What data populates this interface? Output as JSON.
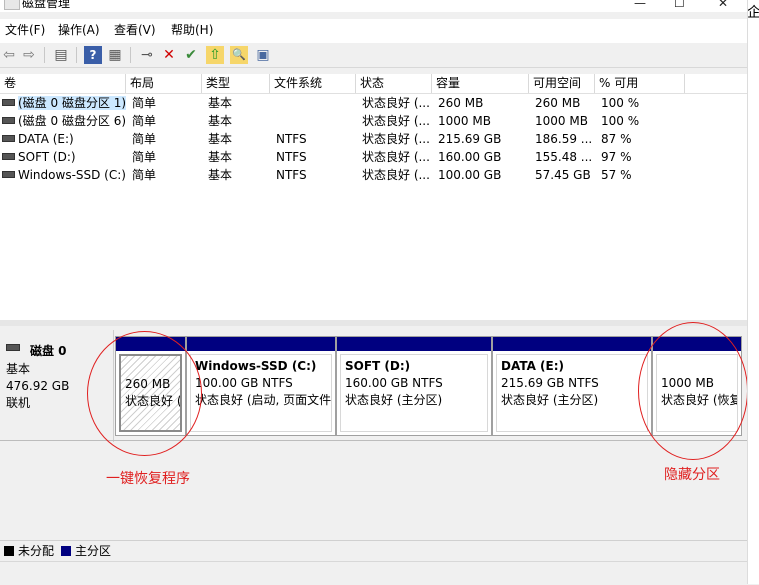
{
  "window": {
    "title": "磁盘管理",
    "minimize_glyph": "—",
    "maximize_glyph": "☐",
    "close_glyph": "✕"
  },
  "menu": [
    "文件(F)",
    "操作(A)",
    "查看(V)",
    "帮助(H)"
  ],
  "toolbar": {
    "icons": [
      "back-icon",
      "forward-icon",
      "console-tree-icon",
      "help-icon",
      "properties-icon",
      "connect-drive-icon",
      "delete-icon",
      "check-icon",
      "open-icon",
      "explore-icon",
      "help-topics-icon"
    ],
    "glyphs": {
      "back": "⇦",
      "forward": "⇨",
      "tree": "▤",
      "help": "?",
      "props": "▦",
      "connect": "⊸",
      "delete": "✕",
      "check": "✔",
      "open": "⇧",
      "explore": "🔍",
      "help2": "▣"
    }
  },
  "volume_table": {
    "headers": [
      "卷",
      "布局",
      "类型",
      "文件系统",
      "状态",
      "容量",
      "可用空间",
      "% 可用"
    ],
    "rows": [
      {
        "volume": "(磁盘 0 磁盘分区 1)",
        "layout": "简单",
        "type": "基本",
        "fs": "",
        "status": "状态良好 (...",
        "capacity": "260 MB",
        "free": "260 MB",
        "pct": "100 %"
      },
      {
        "volume": "(磁盘 0 磁盘分区 6)",
        "layout": "简单",
        "type": "基本",
        "fs": "",
        "status": "状态良好 (...",
        "capacity": "1000 MB",
        "free": "1000 MB",
        "pct": "100 %"
      },
      {
        "volume": "DATA (E:)",
        "layout": "简单",
        "type": "基本",
        "fs": "NTFS",
        "status": "状态良好 (...",
        "capacity": "215.69 GB",
        "free": "186.59 ...",
        "pct": "87 %"
      },
      {
        "volume": "SOFT (D:)",
        "layout": "简单",
        "type": "基本",
        "fs": "NTFS",
        "status": "状态良好 (...",
        "capacity": "160.00 GB",
        "free": "155.48 ...",
        "pct": "97 %"
      },
      {
        "volume": "Windows-SSD (C:)",
        "layout": "简单",
        "type": "基本",
        "fs": "NTFS",
        "status": "状态良好 (...",
        "capacity": "100.00 GB",
        "free": "57.45 GB",
        "pct": "57 %"
      }
    ]
  },
  "disk0": {
    "name": "磁盘 0",
    "type": "基本",
    "size": "476.92 GB",
    "status": "联机",
    "partitions": [
      {
        "name": "",
        "size": "260 MB",
        "status": "状态良好 (",
        "hatched": true
      },
      {
        "name": "Windows-SSD  (C:)",
        "size": "100.00 GB NTFS",
        "status": "状态良好 (启动, 页面文件"
      },
      {
        "name": "SOFT  (D:)",
        "size": "160.00 GB NTFS",
        "status": "状态良好 (主分区)"
      },
      {
        "name": "DATA  (E:)",
        "size": "215.69 GB NTFS",
        "status": "状态良好 (主分区)"
      },
      {
        "name": "",
        "size": "1000 MB",
        "status": "状态良好 (恢复"
      }
    ]
  },
  "annotations": {
    "left_label": "一键恢复程序",
    "right_label": "隐藏分区",
    "color": "#e02020"
  },
  "legend": [
    {
      "label": "未分配",
      "color": "#000000"
    },
    {
      "label": "主分区",
      "color": "#000080"
    }
  ],
  "right_strip_char": "企"
}
